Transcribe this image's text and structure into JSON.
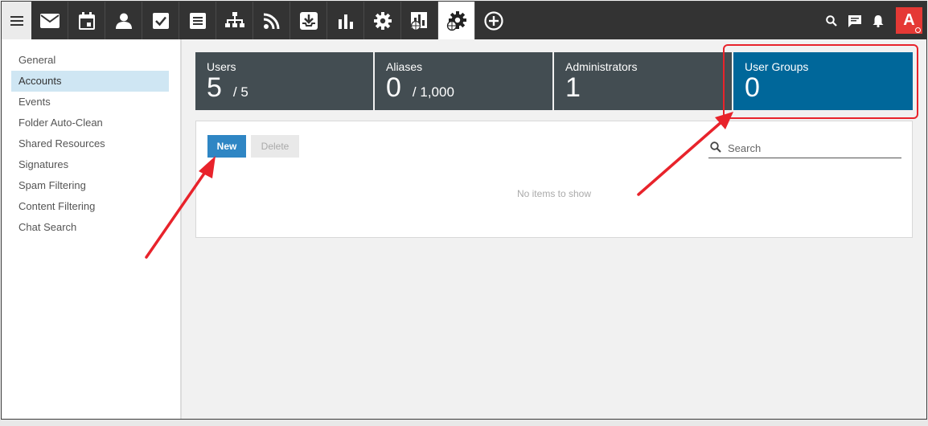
{
  "topbar": {
    "nav_icons": [
      "mail-icon",
      "calendar-icon",
      "contacts-icon",
      "tasks-icon",
      "notes-icon",
      "org-chart-icon",
      "rss-icon",
      "inbox-download-icon",
      "reports-icon",
      "settings-icon",
      "domain-reports-icon",
      "domain-settings-icon",
      "add-circle-icon"
    ],
    "active_icon": "domain-settings-icon",
    "avatar_letter": "A",
    "avatar_color": "#e53935"
  },
  "sidebar": {
    "items": [
      {
        "label": "General"
      },
      {
        "label": "Accounts"
      },
      {
        "label": "Events"
      },
      {
        "label": "Folder Auto-Clean"
      },
      {
        "label": "Shared Resources"
      },
      {
        "label": "Signatures"
      },
      {
        "label": "Spam Filtering"
      },
      {
        "label": "Content Filtering"
      },
      {
        "label": "Chat Search"
      }
    ],
    "active": "Accounts"
  },
  "tiles": [
    {
      "label": "Users",
      "value": "5",
      "max": "/ 5"
    },
    {
      "label": "Aliases",
      "value": "0",
      "max": "/ 1,000"
    },
    {
      "label": "Administrators",
      "value": "1",
      "max": ""
    },
    {
      "label": "User Groups",
      "value": "0",
      "max": ""
    }
  ],
  "toolbar": {
    "new_label": "New",
    "delete_label": "Delete"
  },
  "search": {
    "placeholder": "Search"
  },
  "list": {
    "empty_text": "No items to show"
  },
  "colors": {
    "accent": "#00679a",
    "tile_bg": "#434d52",
    "button_blue": "#2f86c4",
    "annotation_red": "#e8232b"
  }
}
